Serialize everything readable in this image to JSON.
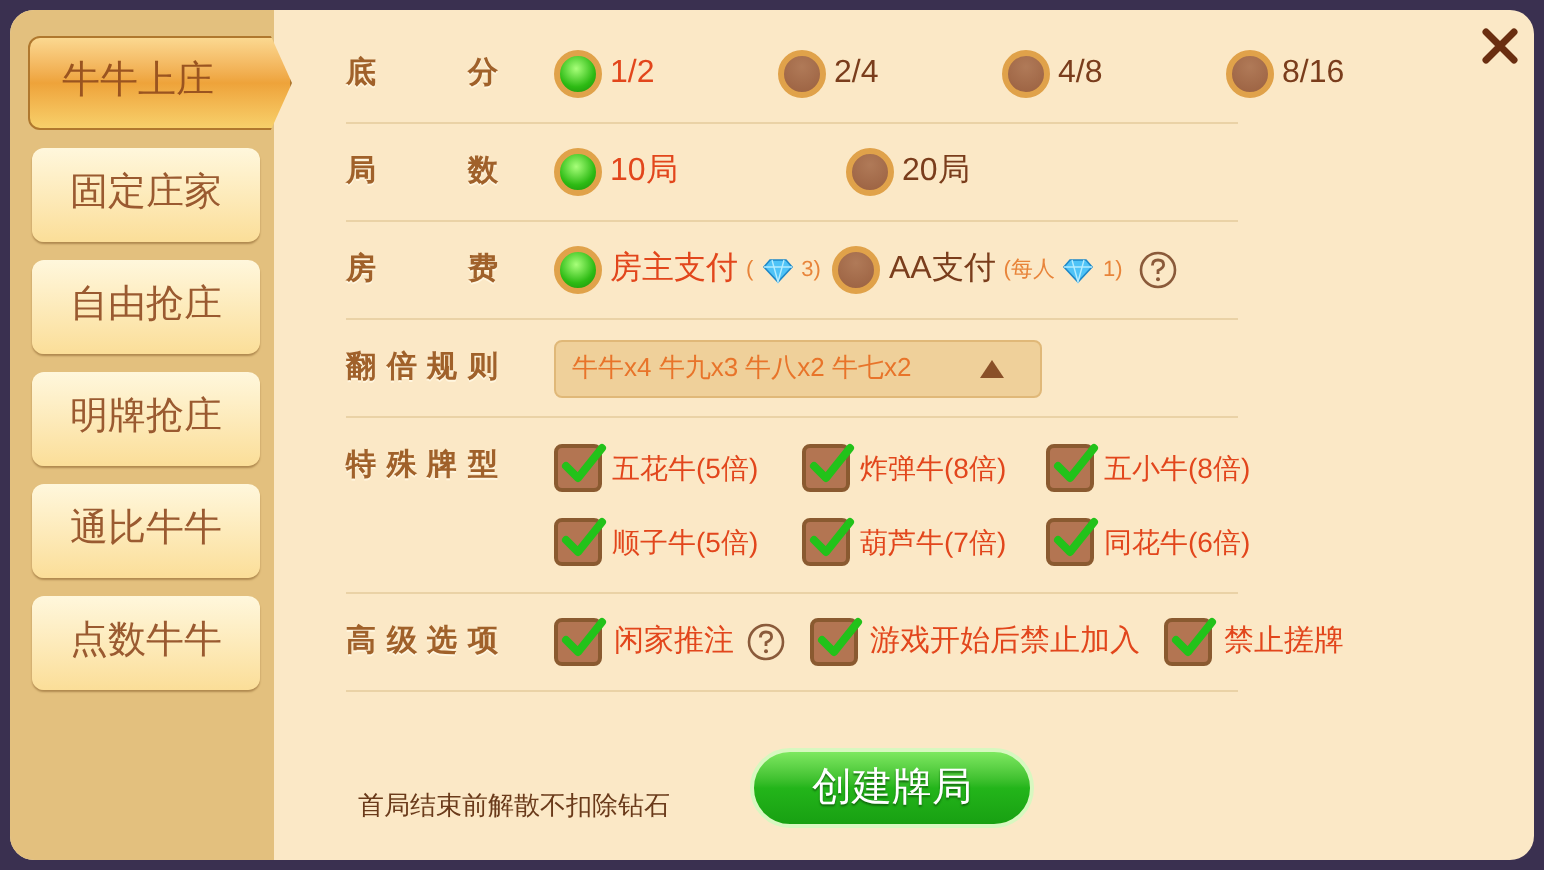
{
  "tabs": [
    {
      "label": "牛牛上庄",
      "selected": true
    },
    {
      "label": "固定庄家",
      "selected": false
    },
    {
      "label": "自由抢庄",
      "selected": false
    },
    {
      "label": "明牌抢庄",
      "selected": false
    },
    {
      "label": "通比牛牛",
      "selected": false
    },
    {
      "label": "点数牛牛",
      "selected": false
    }
  ],
  "rows": [
    {
      "kind": "radio",
      "label": "底 分",
      "options": [
        {
          "label": "1/2",
          "selected": true
        },
        {
          "label": "2/4",
          "selected": false
        },
        {
          "label": "4/8",
          "selected": false
        },
        {
          "label": "8/16",
          "selected": false
        }
      ]
    },
    {
      "kind": "radio",
      "label": "局 数",
      "options": [
        {
          "label": "10局",
          "selected": true
        },
        {
          "label": "20局",
          "selected": false
        }
      ]
    },
    {
      "kind": "radio",
      "label": "房 费",
      "options": [
        {
          "label": "房主支付",
          "note_prefix": "(",
          "note_suffix": "3)",
          "selected": true,
          "help": false
        },
        {
          "label": "AA支付",
          "note_prefix": "(每人",
          "note_suffix": "1)",
          "selected": false,
          "help": true
        }
      ]
    },
    {
      "kind": "dropdown",
      "label": "翻倍规则",
      "value": "牛牛x4 牛九x3 牛八x2 牛七x2"
    },
    {
      "kind": "checkbox",
      "label": "特殊牌型",
      "options": [
        {
          "label": "五花牛(5倍)",
          "checked": true,
          "help": false
        },
        {
          "label": "炸弹牛(8倍)",
          "checked": true,
          "help": false
        },
        {
          "label": "五小牛(8倍)",
          "checked": true,
          "help": false
        },
        {
          "label": "顺子牛(5倍)",
          "checked": true,
          "help": false
        },
        {
          "label": "葫芦牛(7倍)",
          "checked": true,
          "help": false
        },
        {
          "label": "同花牛(6倍)",
          "checked": true,
          "help": false
        }
      ]
    },
    {
      "kind": "checkbox-flow",
      "label": "高级选项",
      "options": [
        {
          "label": "闲家推注",
          "checked": true,
          "help": true
        },
        {
          "label": "游戏开始后禁止加入",
          "checked": true,
          "help": false
        },
        {
          "label": "禁止搓牌",
          "checked": true,
          "help": false
        }
      ]
    }
  ],
  "footer_note": "首局结束前解散不扣除钻石",
  "create_button": "创建牌局"
}
